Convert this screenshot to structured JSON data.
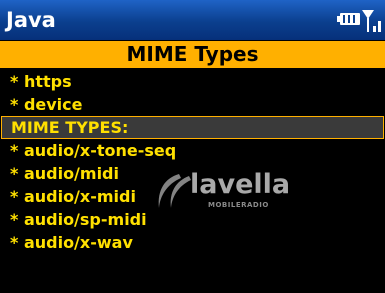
{
  "titlebar": {
    "title": "Java",
    "battery_icon": "battery-icon",
    "signal_icon": "signal-icon"
  },
  "header": {
    "title": "MIME Types"
  },
  "list": {
    "items": [
      {
        "label": "* https"
      },
      {
        "label": "* device"
      },
      {
        "label": "MIME TYPES:"
      },
      {
        "label": "* audio/x-tone-seq"
      },
      {
        "label": "* audio/midi"
      },
      {
        "label": "* audio/x-midi"
      },
      {
        "label": "* audio/sp-midi"
      },
      {
        "label": "* audio/x-wav"
      }
    ]
  },
  "watermark": {
    "logo_text": "lavella",
    "sub_text": "MOBILERADIO"
  },
  "colors": {
    "titlebar_blue": "#0b3f8e",
    "header_orange": "#ffb000",
    "item_text": "#ffe000",
    "background": "#000000"
  }
}
